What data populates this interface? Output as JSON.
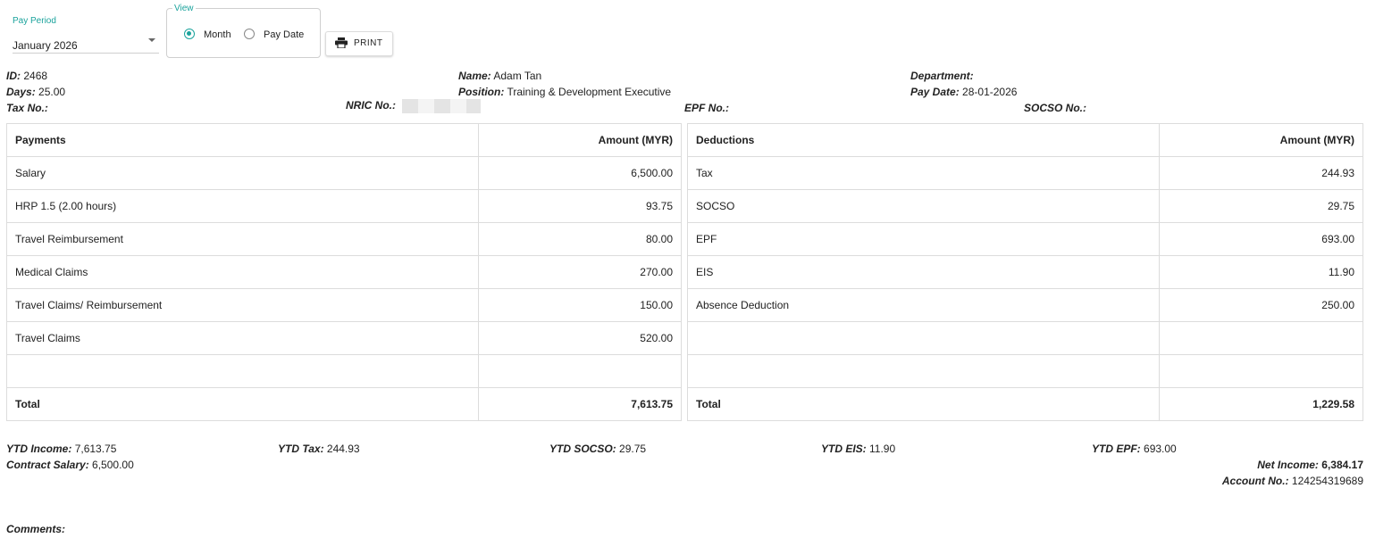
{
  "filters": {
    "pay_period_label": "Pay Period",
    "pay_period_value": "January 2026",
    "view_label": "View",
    "view_options": [
      "Month",
      "Pay Date"
    ],
    "view_selected": "Month",
    "print_label": "PRINT"
  },
  "employee": {
    "id_label": "ID:",
    "id": "2468",
    "name_label": "Name:",
    "name": "Adam Tan",
    "department_label": "Department:",
    "department": "",
    "days_label": "Days:",
    "days": "25.00",
    "position_label": "Position:",
    "position": "Training & Development Executive",
    "pay_date_label": "Pay Date:",
    "pay_date": "28-01-2026",
    "tax_no_label": "Tax No.:",
    "tax_no": "",
    "nric_label": "NRIC No.:",
    "nric": "",
    "epf_no_label": "EPF No.:",
    "epf_no": "",
    "socso_no_label": "SOCSO No.:",
    "socso_no": ""
  },
  "payments": {
    "header": "Payments",
    "amount_header": "Amount (MYR)",
    "rows": [
      {
        "label": "Salary",
        "amount": "6,500.00"
      },
      {
        "label": "HRP 1.5 (2.00 hours)",
        "amount": "93.75"
      },
      {
        "label": "Travel Reimbursement",
        "amount": "80.00"
      },
      {
        "label": "Medical Claims",
        "amount": "270.00"
      },
      {
        "label": "Travel Claims/ Reimbursement",
        "amount": "150.00"
      },
      {
        "label": "Travel Claims",
        "amount": "520.00"
      },
      {
        "label": "",
        "amount": ""
      }
    ],
    "total_label": "Total",
    "total": "7,613.75"
  },
  "deductions": {
    "header": "Deductions",
    "amount_header": "Amount (MYR)",
    "rows": [
      {
        "label": "Tax",
        "amount": "244.93"
      },
      {
        "label": "SOCSO",
        "amount": "29.75"
      },
      {
        "label": "EPF",
        "amount": "693.00"
      },
      {
        "label": "EIS",
        "amount": "11.90"
      },
      {
        "label": "Absence Deduction",
        "amount": "250.00"
      },
      {
        "label": "",
        "amount": ""
      },
      {
        "label": "",
        "amount": ""
      }
    ],
    "total_label": "Total",
    "total": "1,229.58"
  },
  "summary": {
    "ytd_income_label": "YTD Income:",
    "ytd_income": "7,613.75",
    "ytd_tax_label": "YTD Tax:",
    "ytd_tax": "244.93",
    "ytd_socso_label": "YTD SOCSO:",
    "ytd_socso": "29.75",
    "ytd_eis_label": "YTD EIS:",
    "ytd_eis": "11.90",
    "ytd_epf_label": "YTD EPF:",
    "ytd_epf": "693.00",
    "contract_salary_label": "Contract Salary:",
    "contract_salary": "6,500.00",
    "net_income_label": "Net Income:",
    "net_income": "6,384.17",
    "account_no_label": "Account No.:",
    "account_no": "124254319689",
    "comments_label": "Comments:"
  },
  "colors": {
    "accent": "#1ba39c"
  }
}
